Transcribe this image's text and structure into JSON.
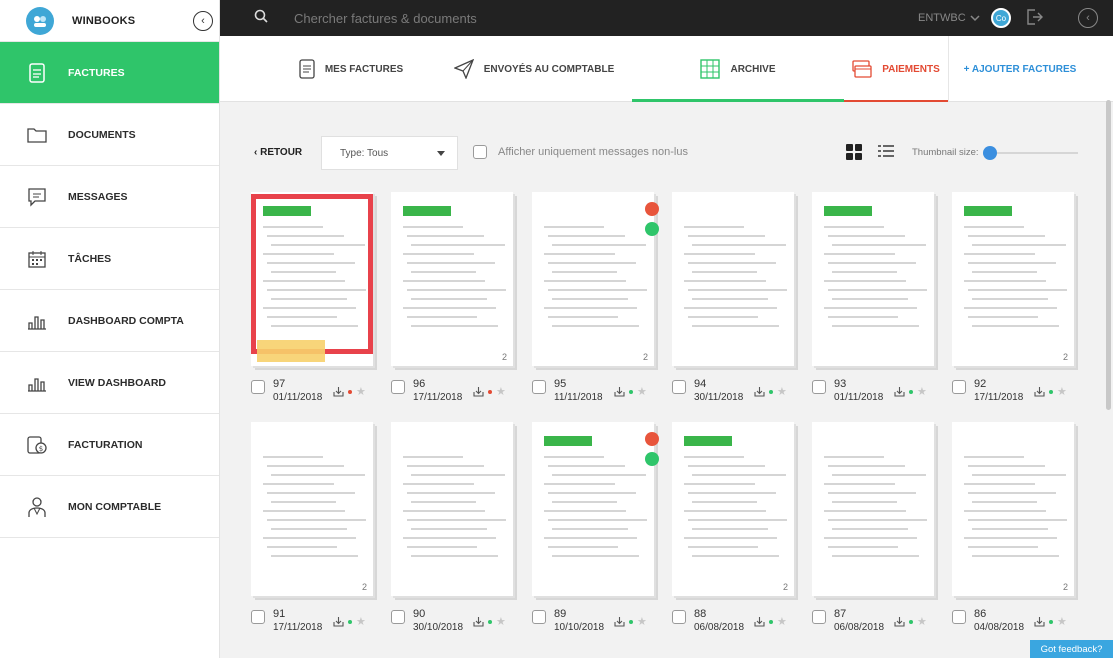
{
  "brand": {
    "name": "WINBOOKS"
  },
  "sidebar": {
    "items": [
      {
        "label": "FACTURES",
        "icon": "file-icon",
        "active": true
      },
      {
        "label": "DOCUMENTS",
        "icon": "folder-icon",
        "active": false
      },
      {
        "label": "MESSAGES",
        "icon": "message-icon",
        "active": false
      },
      {
        "label": "TÂCHES",
        "icon": "calendar-icon",
        "active": false
      },
      {
        "label": "DASHBOARD COMPTA",
        "icon": "bar-chart-icon",
        "active": false
      },
      {
        "label": "VIEW DASHBOARD",
        "icon": "bar-chart-icon",
        "active": false
      },
      {
        "label": "FACTURATION",
        "icon": "invoice-icon",
        "active": false
      },
      {
        "label": "MON COMPTABLE",
        "icon": "accountant-icon",
        "active": false
      }
    ]
  },
  "topbar": {
    "search_placeholder": "Chercher factures & documents",
    "account": "ENTWBC",
    "avatar_initials": "Co"
  },
  "tabs": {
    "mes_factures": "MES FACTURES",
    "envoyes": "ENVOYÉS AU COMPTABLE",
    "archive": "ARCHIVE",
    "paiements": "PAIEMENTS",
    "ajouter": "+ AJOUTER FACTURES"
  },
  "toolbar": {
    "retour": "RETOUR",
    "type_select": "Type: Tous",
    "unread_label": "Afficher uniquement messages non-lus",
    "thumbnail_label": "Thumbnail size:",
    "thumbnail_size": 0.0
  },
  "cards": [
    {
      "num": "97",
      "date": "01/11/2018",
      "dot": "red",
      "pages": "",
      "selected": true
    },
    {
      "num": "96",
      "date": "17/11/2018",
      "dot": "red",
      "pages": "2",
      "selected": false
    },
    {
      "num": "95",
      "date": "11/11/2018",
      "dot": "green",
      "pages": "2",
      "selected": false
    },
    {
      "num": "94",
      "date": "30/11/2018",
      "dot": "green",
      "pages": "",
      "selected": false
    },
    {
      "num": "93",
      "date": "01/11/2018",
      "dot": "green",
      "pages": "",
      "selected": false
    },
    {
      "num": "92",
      "date": "17/11/2018",
      "dot": "green",
      "pages": "2",
      "selected": false
    },
    {
      "num": "91",
      "date": "17/11/2018",
      "dot": "green",
      "pages": "2",
      "selected": false
    },
    {
      "num": "90",
      "date": "30/10/2018",
      "dot": "green",
      "pages": "",
      "selected": false
    },
    {
      "num": "89",
      "date": "10/10/2018",
      "dot": "green",
      "pages": "",
      "selected": false
    },
    {
      "num": "88",
      "date": "06/08/2018",
      "dot": "green",
      "pages": "2",
      "selected": false
    },
    {
      "num": "87",
      "date": "06/08/2018",
      "dot": "green",
      "pages": "",
      "selected": false
    },
    {
      "num": "86",
      "date": "04/08/2018",
      "dot": "green",
      "pages": "2",
      "selected": false
    }
  ],
  "feedback": "Got feedback?",
  "colors": {
    "green": "#2fc56a",
    "red": "#e34a33",
    "blue": "#2d8fd8"
  }
}
